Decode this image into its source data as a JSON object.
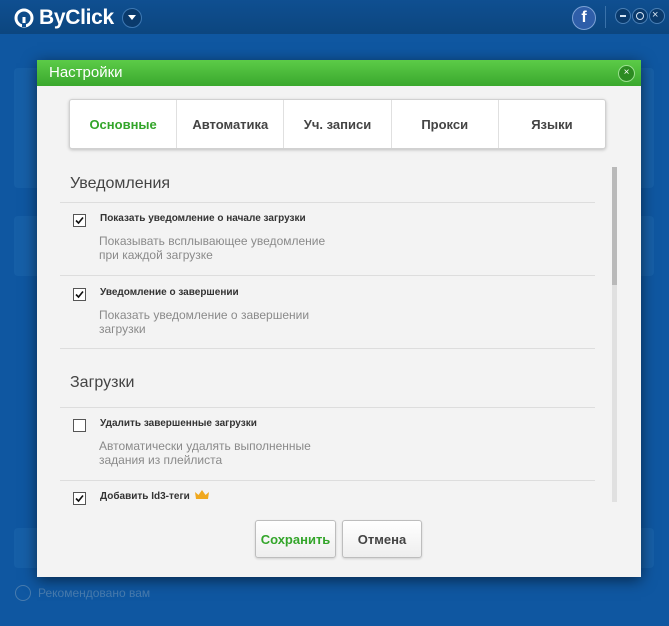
{
  "app": {
    "name": "ByClick",
    "facebook_icon": "f",
    "bg_recommend_label": "Рекомендовано вам"
  },
  "dialog": {
    "title": "Настройки",
    "close_icon": "×"
  },
  "tabs": [
    {
      "label": "Основные",
      "active": true
    },
    {
      "label": "Автоматика",
      "active": false
    },
    {
      "label": "Уч. записи",
      "active": false
    },
    {
      "label": "Прокси",
      "active": false
    },
    {
      "label": "Языки",
      "active": false
    }
  ],
  "sections": [
    {
      "title": "Уведомления",
      "options": [
        {
          "label": "Показать уведомление о начале загрузки",
          "description": "Показывать всплывающее уведомление при каждой загрузке",
          "checked": true
        },
        {
          "label": "Уведомление о завершении",
          "description": "Показать уведомление о завершении загрузки",
          "checked": true
        }
      ]
    },
    {
      "title": "Загрузки",
      "options": [
        {
          "label": "Удалить завершенные загрузки",
          "description": "Автоматически удалять выполненные задания из плейлиста",
          "checked": false
        },
        {
          "label": "Добавить Id3-теги",
          "description": "",
          "checked": true,
          "premium_icon": "crown-icon"
        }
      ]
    }
  ],
  "buttons": {
    "save": "Сохранить",
    "cancel": "Отмена"
  },
  "colors": {
    "accent_green": "#33a52a",
    "header_green": "#3aa82d",
    "app_blue": "#1771c8"
  }
}
